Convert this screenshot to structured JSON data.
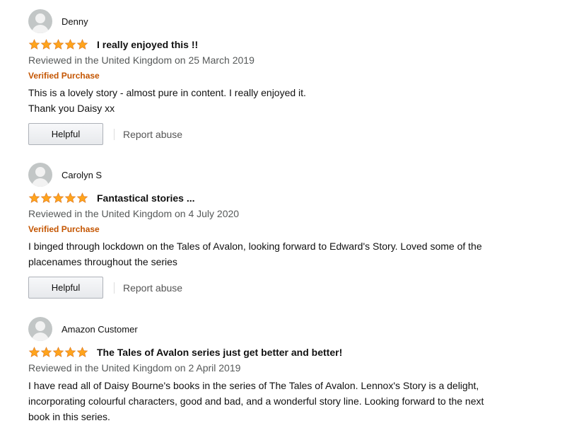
{
  "colors": {
    "star": "#ffa41c",
    "verified": "#c45500",
    "secondary_text": "#565959",
    "avatar_bg": "#c2c6c6"
  },
  "reviews": [
    {
      "author": "Denny",
      "rating": 5,
      "title": "I really enjoyed this !!",
      "date": "Reviewed in the United Kingdom on 25 March 2019",
      "verified": "Verified Purchase",
      "body": [
        "This is a lovely story - almost pure in content. I really enjoyed it.",
        "Thank you Daisy xx"
      ],
      "helpful_label": "Helpful",
      "report_label": "Report abuse"
    },
    {
      "author": "Carolyn S",
      "rating": 5,
      "title": "Fantastical stories ...",
      "date": "Reviewed in the United Kingdom on 4 July 2020",
      "verified": "Verified Purchase",
      "body": [
        "I binged through lockdown on the Tales of Avalon, looking forward to Edward's Story. Loved some of the",
        "placenames throughout the series"
      ],
      "helpful_label": "Helpful",
      "report_label": "Report abuse"
    },
    {
      "author": "Amazon Customer",
      "rating": 5,
      "title": "The Tales of Avalon series just get better and better!",
      "date": "Reviewed in the United Kingdom on 2 April 2019",
      "body": [
        "I have read all of Daisy Bourne's books in the series of The Tales of Avalon. Lennox's Story is a delight,",
        "incorporating colourful characters, good and bad, and a wonderful story line. Looking forward to the next",
        "book in this series."
      ]
    }
  ]
}
